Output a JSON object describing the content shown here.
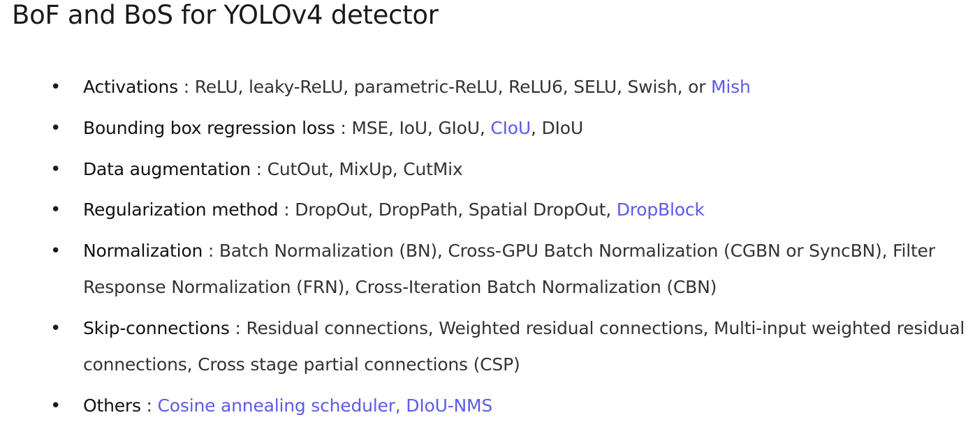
{
  "title": "BoF and BoS for YOLOv4 detector",
  "colors": {
    "highlight": "#5b5bea",
    "text": "#333333",
    "label": "#111111"
  },
  "items": [
    {
      "label": "Activations",
      "sep": " : ",
      "plain": "ReLU, leaky-ReLU, parametric-ReLU, ReLU6, SELU, Swish, or ",
      "highlight": "Mish",
      "tail_sep": "",
      "tail": ""
    },
    {
      "label": "Bounding box regression loss",
      "sep": " : ",
      "plain": "MSE, IoU, GIoU, ",
      "highlight": "CIoU",
      "tail_sep": "",
      "tail": ", DIoU"
    },
    {
      "label": "Data augmentation",
      "sep": " : ",
      "plain": "CutOut, MixUp, CutMix",
      "highlight": "",
      "tail_sep": "",
      "tail": ""
    },
    {
      "label": "Regularization method",
      "sep": " : ",
      "plain": "DropOut, DropPath, Spatial DropOut, ",
      "highlight": "DropBlock",
      "tail_sep": "",
      "tail": ""
    },
    {
      "label": "Normalization",
      "sep": " : ",
      "plain": "Batch Normalization (BN), Cross-GPU Batch Normalization (CGBN or SyncBN), Filter Response Normalization (FRN), Cross-Iteration Batch Normalization (CBN)",
      "highlight": "",
      "tail_sep": "",
      "tail": ""
    },
    {
      "label": "Skip-connections",
      "sep": " : ",
      "plain": "Residual connections, Weighted residual connections, Multi-input weighted residual connections, Cross stage partial connections (CSP)",
      "highlight": "",
      "tail_sep": "",
      "tail": ""
    },
    {
      "label": "Others",
      "sep": " : ",
      "plain": "",
      "highlight": "Cosine annealing scheduler, DIoU-NMS",
      "tail_sep": "",
      "tail": ""
    }
  ]
}
